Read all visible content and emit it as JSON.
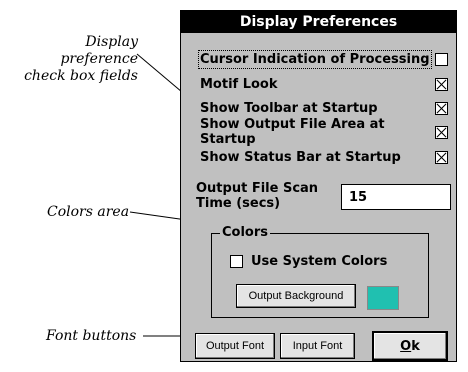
{
  "callouts": {
    "display_pref_line1": "Display preference",
    "display_pref_line2": "check box fields",
    "colors_area": "Colors area",
    "font_buttons": "Font buttons"
  },
  "dialog": {
    "title": "Display Preferences",
    "preferences": [
      {
        "label": "Cursor Indication of Processing",
        "checked": false
      },
      {
        "label": "Motif Look",
        "checked": true
      },
      {
        "label": "Show Toolbar at Startup",
        "checked": true
      },
      {
        "label": "Show Output File Area at Startup",
        "checked": true
      },
      {
        "label": "Show Status Bar at Startup",
        "checked": true
      }
    ],
    "scan_time": {
      "label_line1": "Output File Scan",
      "label_line2": "Time (secs)",
      "value": "15"
    },
    "colors": {
      "legend": "Colors",
      "use_system_colors_label": "Use System Colors",
      "use_system_colors_checked": false,
      "output_background_label": "Output Background",
      "swatch_color": "#20c0b0"
    },
    "buttons": {
      "output_font": "Output Font",
      "input_font": "Input Font",
      "ok_mnemonic": "O",
      "ok_rest": "k"
    }
  }
}
